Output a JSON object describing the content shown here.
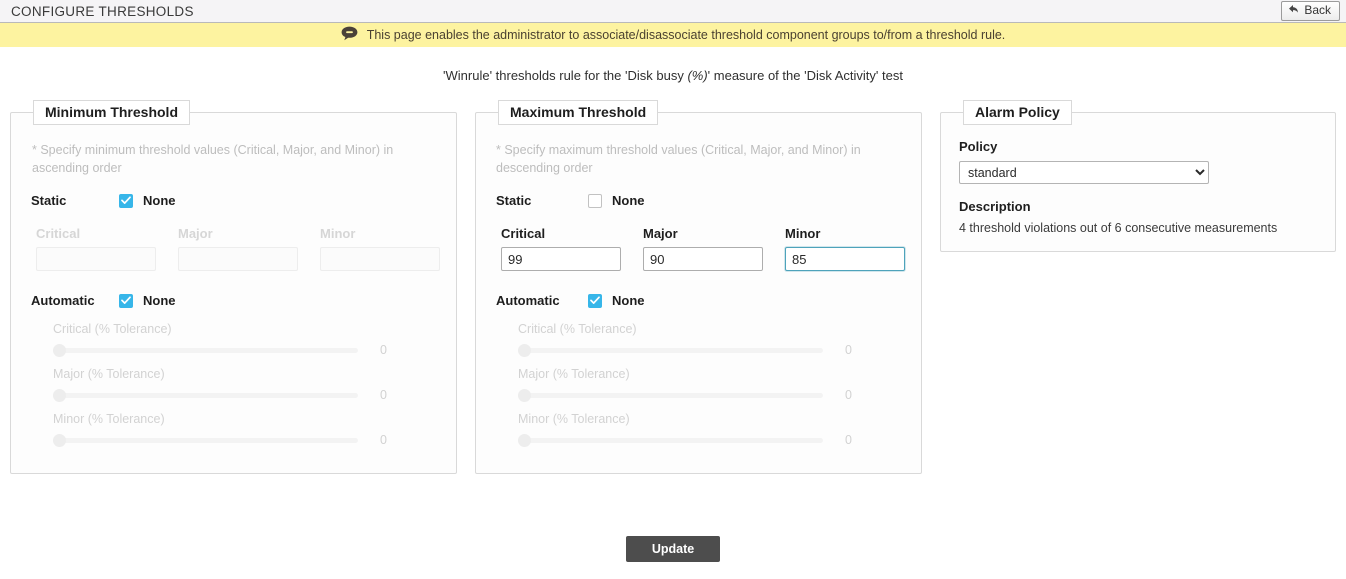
{
  "header": {
    "title": "CONFIGURE THRESHOLDS",
    "back_label": "Back",
    "back_icon": "back-arrow-icon"
  },
  "info_bar": {
    "icon": "speech-bubble-icon",
    "message": "This page enables the administrator to associate/disassociate threshold component groups to/from a threshold rule."
  },
  "subtitle": {
    "prefix": "'Winrule' thresholds rule for the 'Disk busy ",
    "emphasis": "(%)",
    "suffix": "' measure of the 'Disk Activity' test"
  },
  "minimum_threshold": {
    "legend": "Minimum Threshold",
    "hint": "* Specify minimum threshold values (Critical, Major, and Minor) in ascending order",
    "static": {
      "label": "Static",
      "none_label": "None",
      "checked": true,
      "fields": [
        {
          "label": "Critical",
          "value": "",
          "disabled": true
        },
        {
          "label": "Major",
          "value": "",
          "disabled": true
        },
        {
          "label": "Minor",
          "value": "",
          "disabled": true
        }
      ]
    },
    "automatic": {
      "label": "Automatic",
      "none_label": "None",
      "checked": true,
      "sliders": [
        {
          "label": "Critical (% Tolerance)",
          "value": "0"
        },
        {
          "label": "Major (% Tolerance)",
          "value": "0"
        },
        {
          "label": "Minor (% Tolerance)",
          "value": "0"
        }
      ]
    }
  },
  "maximum_threshold": {
    "legend": "Maximum Threshold",
    "hint": "* Specify maximum threshold values (Critical, Major, and Minor) in descending order",
    "static": {
      "label": "Static",
      "none_label": "None",
      "checked": false,
      "fields": [
        {
          "label": "Critical",
          "value": "99",
          "disabled": false
        },
        {
          "label": "Major",
          "value": "90",
          "disabled": false
        },
        {
          "label": "Minor",
          "value": "85",
          "disabled": false,
          "focused": true
        }
      ]
    },
    "automatic": {
      "label": "Automatic",
      "none_label": "None",
      "checked": true,
      "sliders": [
        {
          "label": "Critical (% Tolerance)",
          "value": "0"
        },
        {
          "label": "Major (% Tolerance)",
          "value": "0"
        },
        {
          "label": "Minor (% Tolerance)",
          "value": "0"
        }
      ]
    }
  },
  "alarm_policy": {
    "legend": "Alarm Policy",
    "policy_label": "Policy",
    "policy_value": "standard",
    "policy_options": [
      "standard"
    ],
    "description_title": "Description",
    "description_text": "4 threshold violations out of 6 consecutive measurements"
  },
  "footer": {
    "update_label": "Update"
  },
  "colors": {
    "accent": "#37b6e9",
    "focus_border": "#4ea3bb",
    "info_bar": "#fdf3a0",
    "button": "#4d4d4d"
  }
}
